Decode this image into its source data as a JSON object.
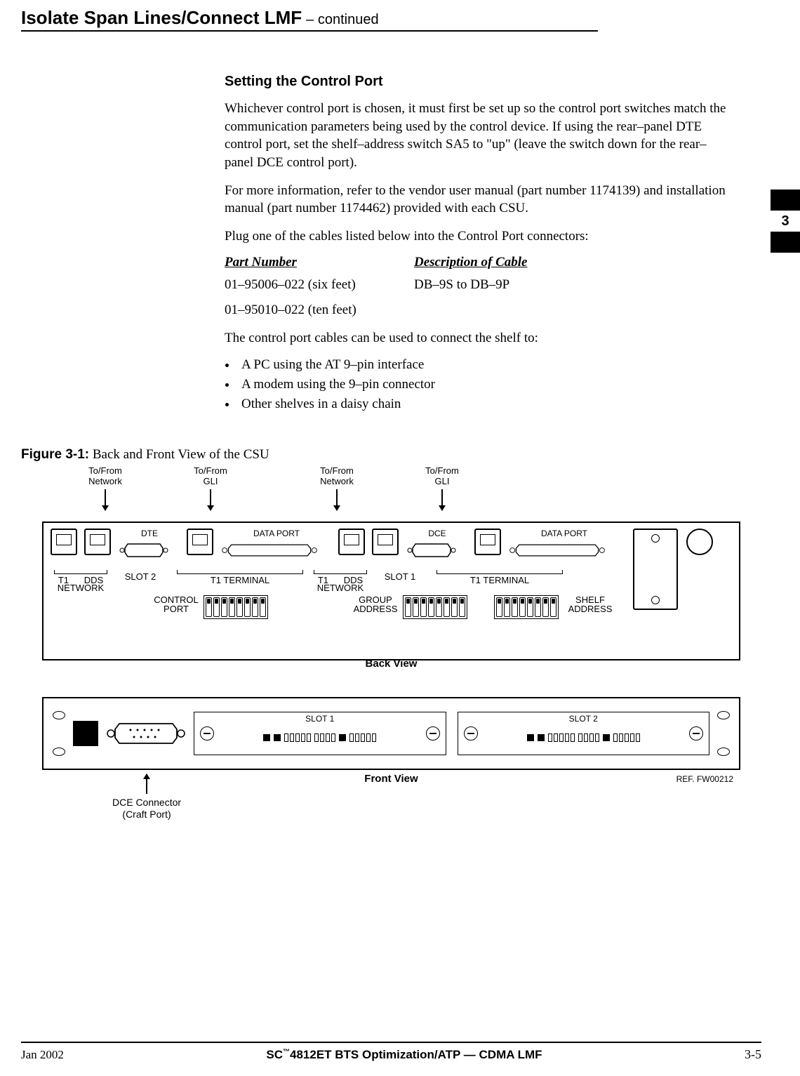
{
  "header": {
    "title": "Isolate Span Lines/Connect LMF",
    "continued": " – continued"
  },
  "tab": {
    "chapter": "3"
  },
  "section": {
    "heading": "Setting the Control Port",
    "p1": "Whichever control port is chosen, it must first be set up so the control port switches match the communication parameters being used by the control device. If using the rear–panel DTE control port, set the shelf–address switch SA5 to \"up\" (leave the switch down for the rear–panel DCE control port).",
    "p2": "For more information, refer to the vendor user manual (part number 1174139) and installation manual (part number 1174462) provided with each CSU.",
    "p3": "Plug one of the cables listed below into the Control Port connectors:",
    "table": {
      "head_pn": "Part Number",
      "head_desc": "Description of Cable",
      "rows": [
        {
          "pn": "01–95006–022 (six feet)",
          "desc": "DB–9S to DB–9P"
        },
        {
          "pn": "01–95010–022 (ten feet)",
          "desc": ""
        }
      ]
    },
    "p4": "The control port cables can be used to connect the shelf to:",
    "bullets": [
      "A PC using the AT 9–pin interface",
      "A modem using the 9–pin connector",
      "Other shelves in a daisy chain"
    ]
  },
  "figure": {
    "caption_bold": "Figure 3-1:",
    "caption_rest": " Back and Front View of the CSU",
    "arrows": {
      "a1": "To/From\nNetwork",
      "a2": "To/From\nGLI",
      "a3": "To/From\nNetwork",
      "a4": "To/From\nGLI"
    },
    "back": {
      "dte": "DTE",
      "dce": "DCE",
      "data_port": "DATA PORT",
      "slot1": "SLOT 1",
      "slot2": "SLOT 2",
      "t1": "T1",
      "dds": "DDS",
      "t1_terminal": "T1 TERMINAL",
      "network": "NETWORK",
      "control_port": "CONTROL\nPORT",
      "group_address": "GROUP\nADDRESS",
      "shelf_address": "SHELF\nADDRESS",
      "view": "Back View"
    },
    "front": {
      "slot1": "SLOT 1",
      "slot2": "SLOT 2",
      "view": "Front View",
      "dce": "DCE Connector\n(Craft Port)",
      "ref": "REF. FW00212"
    }
  },
  "footer": {
    "date": "Jan 2002",
    "doc": "4812ET BTS Optimization/ATP — CDMA LMF",
    "brand": "SC",
    "tm": "™",
    "page": "3-5"
  }
}
